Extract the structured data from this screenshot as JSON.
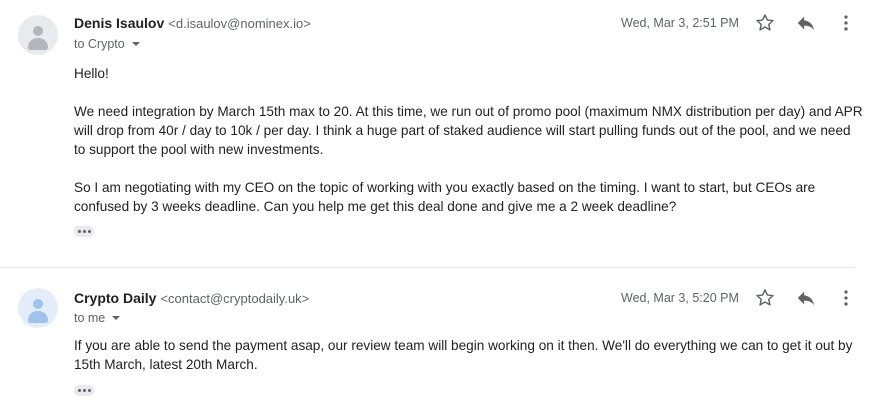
{
  "messages": [
    {
      "sender_name": "Denis Isaulov",
      "sender_email": "<d.isaulov@nominex.io>",
      "recipient": "to Crypto",
      "timestamp": "Wed, Mar 3, 2:51 PM",
      "avatar_color": "#b3b7bc",
      "paragraphs": [
        "Hello!",
        "We need integration by March 15th max to 20. At this time, we run out of promo pool (maximum NMX distribution per day) and APR will drop from 40r / day to 10k / per day. I think a huge part of staked audience will start pulling funds out of the pool, and we need to support the pool with new investments.",
        "So I am negotiating with my CEO on the topic of working with you exactly based on the timing. I want to start, but CEOs are confused by 3 weeks deadline. Can you help me get this deal done and give me a 2 week deadline?"
      ]
    },
    {
      "sender_name": "Crypto Daily",
      "sender_email": "<contact@cryptodaily.uk>",
      "recipient": "to me",
      "timestamp": "Wed, Mar 3, 5:20 PM",
      "avatar_color": "#9fc3ea",
      "paragraphs": [
        "If you are able to send the payment asap, our review team will begin working on it then. We'll do everything we can to get it out by 15th March, latest 20th March."
      ]
    }
  ],
  "icons": [
    "star-icon",
    "reply-icon",
    "more-vert-icon",
    "avatar-person-icon",
    "trimmed-content-icon"
  ]
}
